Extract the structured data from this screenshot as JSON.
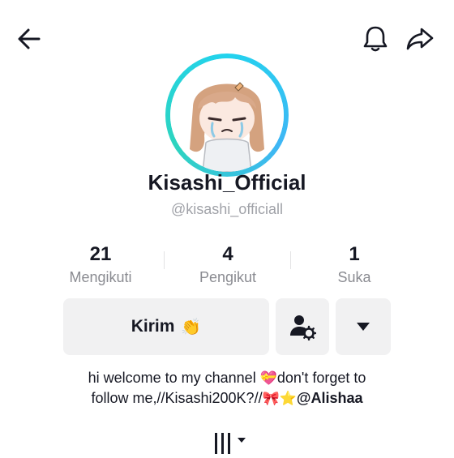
{
  "header": {
    "back_icon": "back-arrow-icon",
    "bell_icon": "bell-icon",
    "share_icon": "share-arrow-icon"
  },
  "profile": {
    "display_name": "Kisashi_Official",
    "username": "@kisashi_officiall",
    "avatar_ring_color": "#22d3ee"
  },
  "stats": [
    {
      "value": "21",
      "label": "Mengikuti"
    },
    {
      "value": "4",
      "label": "Pengikut"
    },
    {
      "value": "1",
      "label": "Suka"
    }
  ],
  "actions": {
    "send_label": "Kirim",
    "send_emoji": "👏",
    "add_friend_icon": "person-gear-icon",
    "more_icon": "caret-down-icon"
  },
  "bio": {
    "line1_text": "hi welcome to my channel ",
    "line1_heart": "💝",
    "line1_text2": "don't forget to",
    "line2_text": "follow me,//Kisashi200K?//",
    "line2_ribbon": "🎀",
    "line2_star": "⭐",
    "line2_mention": "@Alishaa"
  },
  "tabs": {
    "icon": "grid-columns-icon"
  }
}
